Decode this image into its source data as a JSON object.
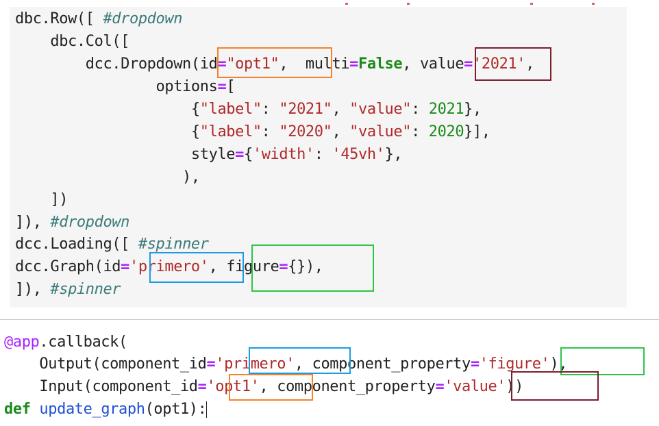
{
  "colors": {
    "orange_box": "#f5822a",
    "maroon_box": "#7b1e2e",
    "blue_box": "#1e9be0",
    "green_box": "#2ec44a"
  },
  "cell1": {
    "l1_a": "dbc.Row([ ",
    "l1_c": "#dropdown",
    "l2_a": "    dbc.Col([",
    "l3_a": "        dcc.Dropdown(id",
    "l3_op1": "=",
    "l3_s1": "\"opt1\"",
    "l3_b": ",  multi",
    "l3_op2": "=",
    "l3_k": "False",
    "l3_c": ", value",
    "l3_op3": "=",
    "l3_s2": "'2021'",
    "l3_d": ",",
    "l4_a": "                options",
    "l4_op": "=",
    "l4_b": "[",
    "l5_a": "                    {",
    "l5_s1": "\"label\"",
    "l5_b": ": ",
    "l5_s2": "\"2021\"",
    "l5_c": ", ",
    "l5_s3": "\"value\"",
    "l5_d": ": ",
    "l5_n": "2021",
    "l5_e": "},",
    "l6_a": "                    {",
    "l6_s1": "\"label\"",
    "l6_b": ": ",
    "l6_s2": "\"2020\"",
    "l6_c": ", ",
    "l6_s3": "\"value\"",
    "l6_d": ": ",
    "l6_n": "2020",
    "l6_e": "}],",
    "l7_a": "                    style",
    "l7_op": "=",
    "l7_b": "{",
    "l7_s1": "'width'",
    "l7_c": ": ",
    "l7_s2": "'45vh'",
    "l7_d": "},",
    "l8_a": "                   ),",
    "l9_a": "    ])",
    "l10_a": "]), ",
    "l10_c": "#dropdown",
    "l11_a": "dcc.Loading([ ",
    "l11_c": "#spinner",
    "l12_a": "dcc.Graph(id",
    "l12_op1": "=",
    "l12_s": "'primero'",
    "l12_b": ", figure",
    "l12_op2": "=",
    "l12_c": "{}),",
    "l13_a": "]), ",
    "l13_c": "#spinner"
  },
  "cell2": {
    "l1_dec": "@app",
    "l1_a": ".callback(",
    "l2_a": "    Output(component_id",
    "l2_op1": "=",
    "l2_s1": "'primero'",
    "l2_b": ", component_property",
    "l2_op2": "=",
    "l2_s2": "'figure'",
    "l2_c": "),",
    "l3_a": "    Input(component_id",
    "l3_op1": "=",
    "l3_s1": "'opt1'",
    "l3_b": ", component_property",
    "l3_op2": "=",
    "l3_s2": "'value'",
    "l3_c": "))",
    "l4_kw": "def",
    "l4_sp": " ",
    "l4_fn": "update_graph",
    "l4_a": "(opt1):"
  }
}
